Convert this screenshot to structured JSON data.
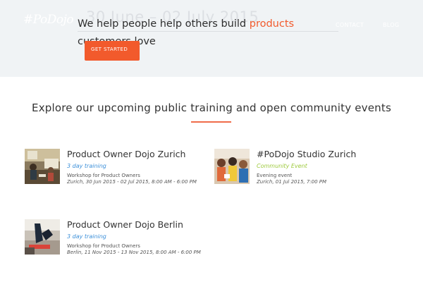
{
  "header": {
    "logo_text": "#PoDojo",
    "nav": [
      "CONTACT",
      "BLOG"
    ],
    "background_date": "30 June – 02 July 2015"
  },
  "hero": {
    "tagline_start": "We help people help others build ",
    "tagline_accent": "products",
    "tagline_end": " customers love",
    "cta_label": "GET STARTED"
  },
  "section": {
    "title": "Explore our upcoming public training and open community events"
  },
  "events": [
    {
      "title": "Product Owner Dojo Zurich",
      "type": "3 day training",
      "description": "Workshop for Product Owners",
      "date": "Zurich, 30 Jun 2015 - 02 Jul 2015, 8:00 AM - 6:00 PM",
      "thumbnail": "workshop-room-photo"
    },
    {
      "title": "#PoDojo Studio Zurich",
      "type": "Community Event",
      "description": "Evening event",
      "date": "Zurich, 01 Jul 2015, 7:00 PM",
      "thumbnail": "community-group-photo"
    },
    {
      "title": "Product Owner Dojo Berlin",
      "type": "3 day training",
      "description": "Workshop for Product Owners",
      "date": "Berlin, 11 Nov 2015 - 13 Nov 2015, 8:00 AM - 6:00 PM",
      "thumbnail": "dojo-floor-photo"
    }
  ],
  "colors": {
    "accent": "#f25a2c",
    "training_type": "#3b8fd9",
    "community_type": "#9cc93a",
    "hero_background": "#f0f3f5"
  }
}
